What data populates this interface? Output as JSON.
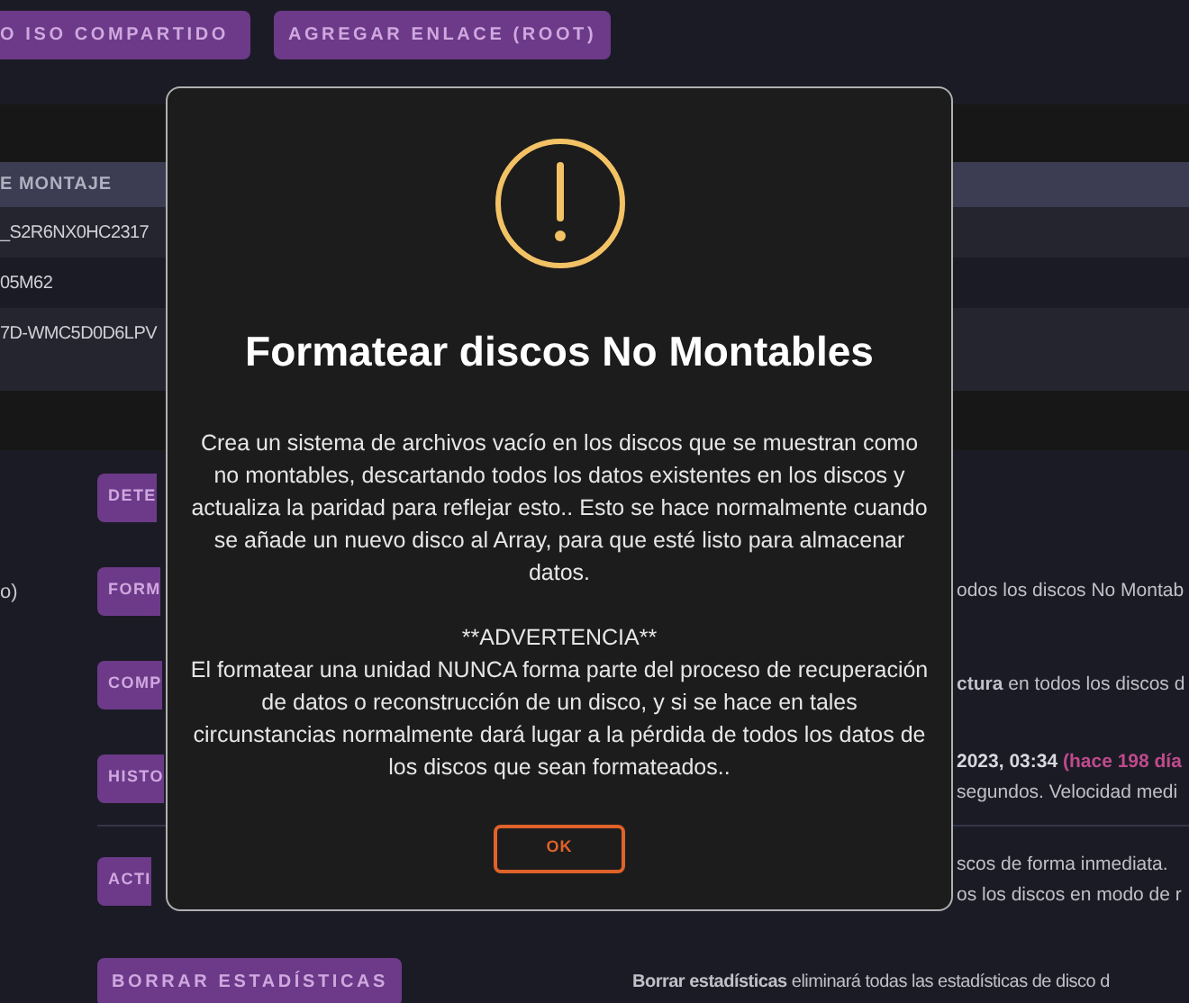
{
  "top_buttons": [
    "O ISO COMPARTIDO",
    "AGREGAR ENLACE (ROOT)"
  ],
  "table": {
    "columns": [
      "E MONTAJE"
    ],
    "rows": [
      [
        "_S2R6NX0HC2317"
      ],
      [
        "05M62"
      ],
      [
        "7D-WMC5D0D6LPV"
      ]
    ]
  },
  "actions": [
    {
      "button": "DETE",
      "covered": true
    },
    {
      "button": "FORM",
      "covered": true,
      "side_note": "o)",
      "lines": [
        "odos los discos No Montab"
      ]
    },
    {
      "button": "COMP",
      "covered": true,
      "lines": [
        "**ctura** en todos los discos d"
      ]
    },
    {
      "button": "HISTO",
      "covered": true,
      "date": "2023, 03:34",
      "ago": "(hace 198 día",
      "lines": [
        "segundos. Velocidad medi"
      ]
    },
    {
      "button": "ACTI",
      "covered": true,
      "divider_above": true,
      "lines": [
        "scos de forma inmediata.",
        "os los discos en modo de r"
      ]
    },
    {
      "button": "BORRAR ESTADÍSTICAS",
      "covered": false,
      "lines": [
        "**Borrar estadísticas** eliminará todas las estadísticas de disco d"
      ]
    }
  ],
  "dialog": {
    "title": "Formatear discos No Montables",
    "paragraphs": [
      "Crea un sistema de archivos vacío en los discos que se muestran como no montables, descartando todos los datos existentes en los discos y actualiza la paridad para reflejar esto.. Esto se hace normalmente cuando se añade un nuevo disco al Array, para que esté listo para almacenar datos.",
      "**ADVERTENCIA**",
      "El formatear una unidad NUNCA forma parte del proceso de recuperación de datos o reconstrucción de un disco, y si se hace en tales circunstancias normalmente dará lugar a la pérdida de todos los datos de los discos que sean formateados.."
    ],
    "button": "OK"
  }
}
